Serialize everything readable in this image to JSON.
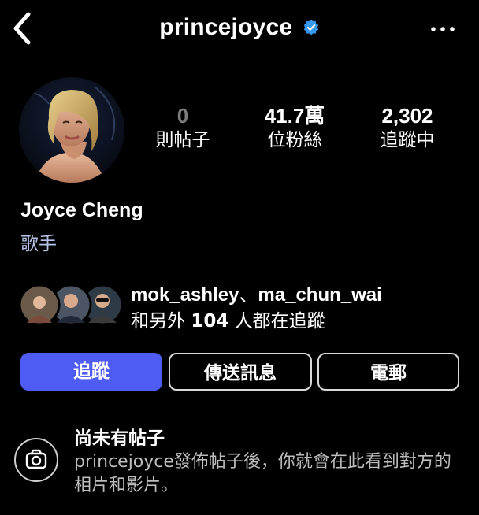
{
  "header": {
    "username": "princejoyce",
    "back_icon": "chevron-left-icon",
    "verified_icon": "verified-badge-icon",
    "more_icon": "more-horizontal-icon"
  },
  "stats": {
    "posts": {
      "value": "0",
      "label": "則帖子"
    },
    "followers": {
      "value": "41.7萬",
      "label": "位粉絲"
    },
    "following": {
      "value": "2,302",
      "label": "追蹤中"
    }
  },
  "profile": {
    "name": "Joyce Cheng",
    "category": "歌手"
  },
  "followed_by": {
    "users": [
      "mok_ashley",
      "ma_chun_wai"
    ],
    "separator": "、",
    "prefix": "和另外 ",
    "count": "104",
    "suffix": " 人都在追蹤"
  },
  "buttons": {
    "follow": "追蹤",
    "message": "傳送訊息",
    "email": "電郵"
  },
  "empty_state": {
    "icon": "camera-icon",
    "title": "尚未有帖子",
    "text": "princejoyce發佈帖子後，你就會在此看到對方的相片和影片。"
  },
  "colors": {
    "background": "#000000",
    "accent": "#4e5cf3",
    "verified": "#3897f0",
    "category": "#b6c3e8"
  }
}
